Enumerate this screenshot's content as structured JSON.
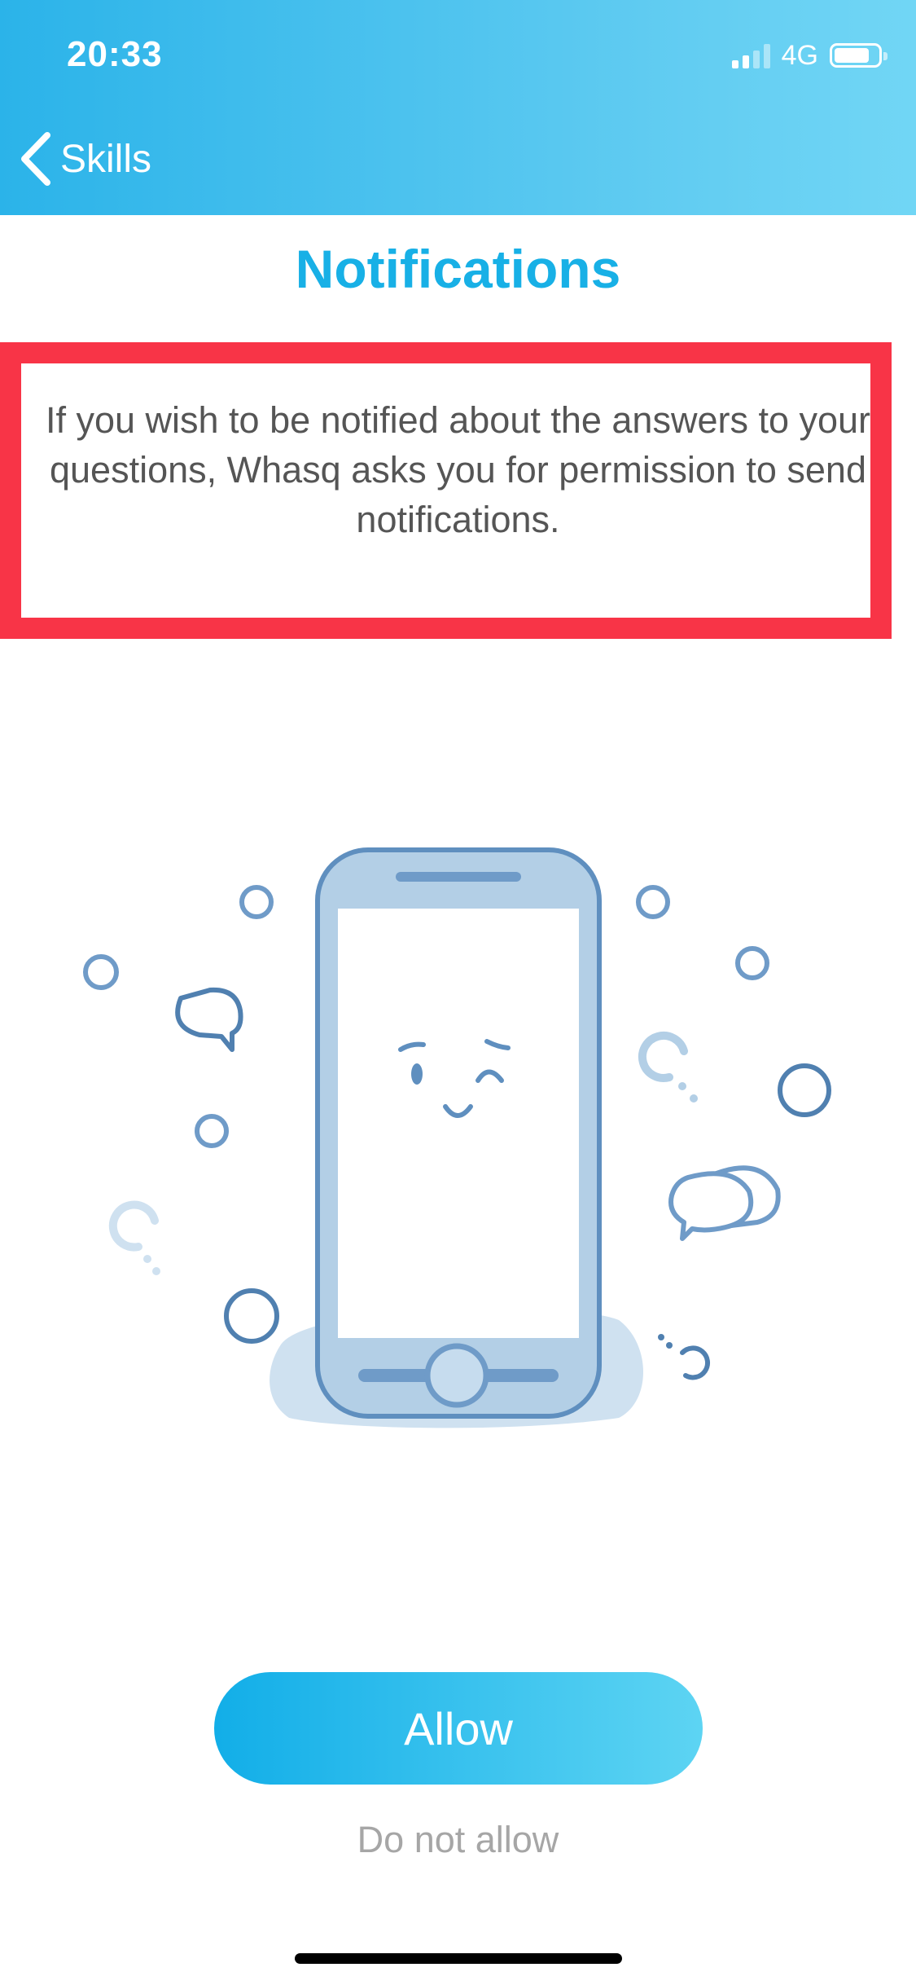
{
  "status_bar": {
    "time": "20:33",
    "network": "4G",
    "signal_icon": "signal-bars-icon",
    "battery_icon": "battery-icon"
  },
  "nav": {
    "back_label": "Skills",
    "back_icon": "chevron-left-icon"
  },
  "page": {
    "title": "Notifications",
    "description": "If you wish to be notified about the answers to your questions, Whasq asks you for permission to send notifications."
  },
  "actions": {
    "allow_label": "Allow",
    "deny_label": "Do not allow"
  },
  "colors": {
    "accent": "#18b0e6",
    "highlight_border": "#f83447",
    "illustration_stroke": "#5f8fbf",
    "illustration_fill": "#b3cfe6"
  }
}
